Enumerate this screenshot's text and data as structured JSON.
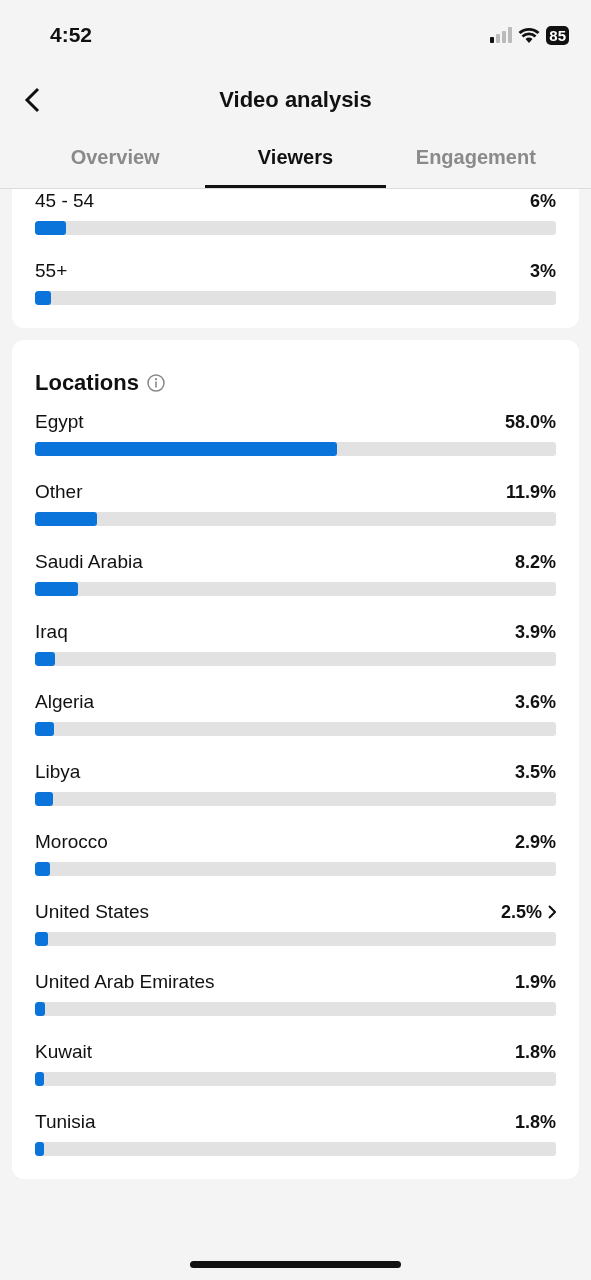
{
  "status_bar": {
    "time": "4:52",
    "battery": "85"
  },
  "header": {
    "title": "Video analysis"
  },
  "tabs": [
    {
      "label": "Overview",
      "selected": false
    },
    {
      "label": "Viewers",
      "selected": true
    },
    {
      "label": "Engagement",
      "selected": false
    }
  ],
  "age_card": {
    "rows": [
      {
        "label": "45 - 54",
        "value": "6%",
        "level": 0.06
      },
      {
        "label": "55+",
        "value": "3%",
        "level": 0.03
      }
    ]
  },
  "locations": {
    "title": "Locations",
    "rows": [
      {
        "label": "Egypt",
        "value": "58.0%",
        "level": 0.58,
        "chevron": false
      },
      {
        "label": "Other",
        "value": "11.9%",
        "level": 0.119,
        "chevron": false
      },
      {
        "label": "Saudi Arabia",
        "value": "8.2%",
        "level": 0.082,
        "chevron": false
      },
      {
        "label": "Iraq",
        "value": "3.9%",
        "level": 0.039,
        "chevron": false
      },
      {
        "label": "Algeria",
        "value": "3.6%",
        "level": 0.036,
        "chevron": false
      },
      {
        "label": "Libya",
        "value": "3.5%",
        "level": 0.035,
        "chevron": false
      },
      {
        "label": "Morocco",
        "value": "2.9%",
        "level": 0.029,
        "chevron": false
      },
      {
        "label": "United States",
        "value": "2.5%",
        "level": 0.025,
        "chevron": true
      },
      {
        "label": "United Arab Emirates",
        "value": "1.9%",
        "level": 0.019,
        "chevron": false
      },
      {
        "label": "Kuwait",
        "value": "1.8%",
        "level": 0.018,
        "chevron": false
      },
      {
        "label": "Tunisia",
        "value": "1.8%",
        "level": 0.018,
        "chevron": false
      }
    ]
  }
}
